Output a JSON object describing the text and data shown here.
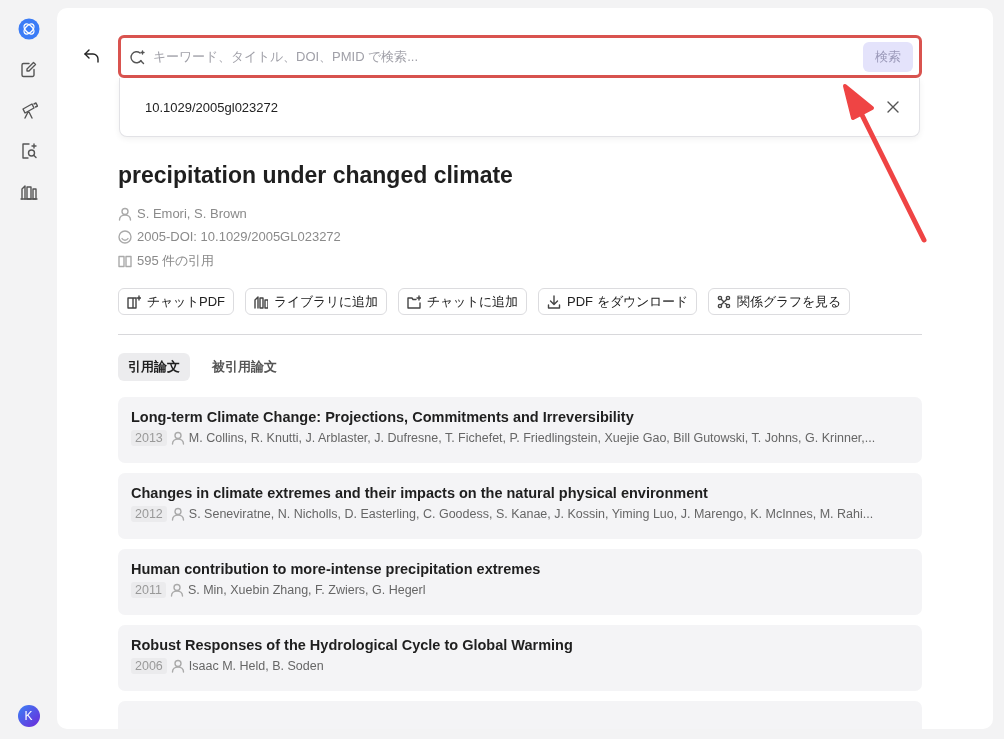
{
  "search": {
    "placeholder": "キーワード、タイトル、DOI、PMID で検索...",
    "button": "検索"
  },
  "suggestion": {
    "text": "10.1029/2005gl023272"
  },
  "paper": {
    "title": "precipitation under changed climate",
    "meta": [
      {
        "kind": "authors",
        "text": "S. Emori, S. Brown"
      },
      {
        "kind": "date",
        "text": "2005-DOI: 10.1029/2005GL023272"
      },
      {
        "kind": "citations",
        "text": "595 件の引用"
      }
    ]
  },
  "actions": [
    {
      "kind": "chat-pdf",
      "label": "チャットPDF"
    },
    {
      "kind": "library",
      "label": "ライブラリに追加"
    },
    {
      "kind": "chat",
      "label": "チャットに追加"
    },
    {
      "kind": "download",
      "label": "PDF をダウンロード"
    },
    {
      "kind": "graph",
      "label": "関係グラフを見る"
    }
  ],
  "tabs": [
    {
      "label": "引用論文",
      "selected": true
    },
    {
      "label": "被引用論文",
      "selected": false
    }
  ],
  "references": [
    {
      "title": "Long-term Climate Change: Projections, Commitments and Irreversibility",
      "year": "2013",
      "authors": "M. Collins, R. Knutti, J. Arblaster, J. Dufresne, T. Fichefet, P. Friedlingstein, Xuejie Gao, Bill Gutowski, T. Johns, G. Krinner,..."
    },
    {
      "title": "Changes in climate extremes and their impacts on the natural physical environment",
      "year": "2012",
      "authors": "S. Seneviratne, N. Nicholls, D. Easterling, C. Goodess, S. Kanae, J. Kossin, Yiming Luo, J. Marengo, K. McInnes, M. Rahi..."
    },
    {
      "title": "Human contribution to more-intense precipitation extremes",
      "year": "2011",
      "authors": "S. Min, Xuebin Zhang, F. Zwiers, G. Hegerl"
    },
    {
      "title": "Robust Responses of the Hydrological Cycle to Global Warming",
      "year": "2006",
      "authors": "Isaac M. Held, B. Soden"
    }
  ],
  "user": {
    "initial": "K"
  }
}
